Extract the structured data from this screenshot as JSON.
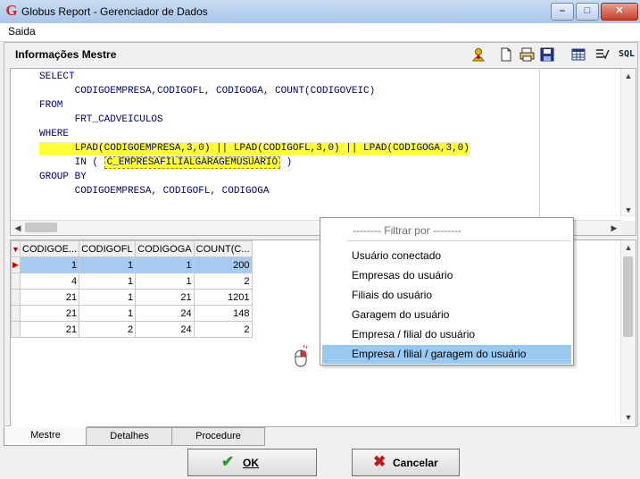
{
  "window": {
    "title": "Globus Report - Gerenciador de Dados",
    "icon": "globus-g-icon"
  },
  "menu": {
    "items": [
      "Saida"
    ]
  },
  "panel": {
    "title": "Informações Mestre",
    "toolbar_icons": [
      "user-warning-icon",
      "new-document-icon",
      "print-icon",
      "save-icon",
      "table-icon",
      "checklist-icon"
    ],
    "sql_label": "SQL"
  },
  "sql": {
    "lines": [
      "SELECT",
      "      CODIGOEMPRESA,CODIGOFL, CODIGOGA, COUNT(CODIGOVEIC)",
      "FROM",
      "      FRT_CADVEICULOS",
      "WHERE",
      "      LPAD(CODIGOEMPRESA,3,0) || LPAD(CODIGOFL,3,0) || LPAD(CODIGOGA,3,0)",
      "      IN ( ",
      "C_EMPRESAFILIALGARAGEMUSUARIO",
      " )",
      "GROUP BY",
      "      CODIGOEMPRESA, CODIGOFL, CODIGOGA"
    ]
  },
  "grid": {
    "columns": [
      "CODIGOE...",
      "CODIGOFL",
      "CODIGOGA",
      "COUNT(C..."
    ],
    "rows": [
      [
        "1",
        "1",
        "1",
        "200"
      ],
      [
        "4",
        "1",
        "1",
        "2"
      ],
      [
        "21",
        "1",
        "21",
        "1201"
      ],
      [
        "21",
        "1",
        "24",
        "148"
      ],
      [
        "21",
        "2",
        "24",
        "2"
      ]
    ],
    "selected_row": 0
  },
  "context_menu": {
    "header": "-------- Filtrar por --------",
    "items": [
      "Usuário conectado",
      "Empresas do usuário",
      "Filiais do usuário",
      "Garagem do usuário",
      "Empresa / filial do usuário",
      "Empresa / filial / garagem do usuário"
    ],
    "active_index": 5
  },
  "tabs": [
    "Mestre",
    "Detalhes",
    "Procedure"
  ],
  "buttons": {
    "ok": "OK",
    "cancel": "Cancelar"
  },
  "colors": {
    "highlight": "#ffff33",
    "selection": "#a6caf0",
    "menu_active": "#99c9ef",
    "sql_text": "#00008b"
  }
}
